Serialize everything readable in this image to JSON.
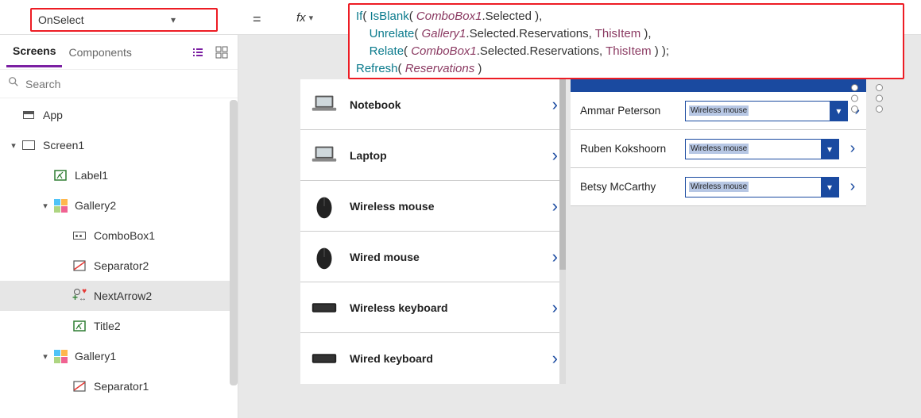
{
  "propbar": {
    "property": "OnSelect",
    "equals": "=",
    "fx": "fx",
    "formula_lines": [
      [
        {
          "t": "fn",
          "v": "If"
        },
        {
          "t": "p",
          "v": "( "
        },
        {
          "t": "fn",
          "v": "IsBlank"
        },
        {
          "t": "p",
          "v": "( "
        },
        {
          "t": "var",
          "v": "ComboBox1"
        },
        {
          "t": "p",
          "v": ".Selected ),"
        }
      ],
      [
        {
          "t": "p",
          "v": "    "
        },
        {
          "t": "fn",
          "v": "Unrelate"
        },
        {
          "t": "p",
          "v": "( "
        },
        {
          "t": "var",
          "v": "Gallery1"
        },
        {
          "t": "p",
          "v": ".Selected.Reservations, "
        },
        {
          "t": "this",
          "v": "ThisItem"
        },
        {
          "t": "p",
          "v": " ),"
        }
      ],
      [
        {
          "t": "p",
          "v": "    "
        },
        {
          "t": "fn",
          "v": "Relate"
        },
        {
          "t": "p",
          "v": "( "
        },
        {
          "t": "var",
          "v": "ComboBox1"
        },
        {
          "t": "p",
          "v": ".Selected.Reservations, "
        },
        {
          "t": "this",
          "v": "ThisItem"
        },
        {
          "t": "p",
          "v": " ) );"
        }
      ],
      [
        {
          "t": "fn",
          "v": "Refresh"
        },
        {
          "t": "p",
          "v": "( "
        },
        {
          "t": "var",
          "v": "Reservations"
        },
        {
          "t": "p",
          "v": " )"
        }
      ]
    ]
  },
  "left": {
    "tabs": {
      "screens": "Screens",
      "components": "Components"
    },
    "search_placeholder": "Search",
    "tree": [
      {
        "level": 0,
        "icon": "app",
        "label": "App",
        "expand": ""
      },
      {
        "level": 1,
        "icon": "screen",
        "label": "Screen1",
        "expand": "▾"
      },
      {
        "level": 2,
        "icon": "label",
        "label": "Label1",
        "expand": ""
      },
      {
        "level": 2,
        "icon": "gallery",
        "label": "Gallery2",
        "expand": "▾"
      },
      {
        "level": 3,
        "icon": "combo",
        "label": "ComboBox1",
        "expand": ""
      },
      {
        "level": 3,
        "icon": "sep",
        "label": "Separator2",
        "expand": ""
      },
      {
        "level": 3,
        "icon": "next",
        "label": "NextArrow2",
        "expand": "",
        "selected": true
      },
      {
        "level": 3,
        "icon": "label",
        "label": "Title2",
        "expand": ""
      },
      {
        "level": 2,
        "icon": "gallery",
        "label": "Gallery1",
        "expand": "▾"
      },
      {
        "level": 3,
        "icon": "sep",
        "label": "Separator1",
        "expand": ""
      }
    ]
  },
  "canvas": {
    "products": [
      {
        "name": "Notebook"
      },
      {
        "name": "Laptop"
      },
      {
        "name": "Wireless mouse"
      },
      {
        "name": "Wired mouse"
      },
      {
        "name": "Wireless keyboard"
      },
      {
        "name": "Wired keyboard"
      }
    ],
    "reservations": [
      {
        "name": "Ammar Peterson",
        "combo": "Wireless mouse",
        "selected": true
      },
      {
        "name": "Ruben Kokshoorn",
        "combo": "Wireless mouse"
      },
      {
        "name": "Betsy McCarthy",
        "combo": "Wireless mouse"
      }
    ]
  }
}
